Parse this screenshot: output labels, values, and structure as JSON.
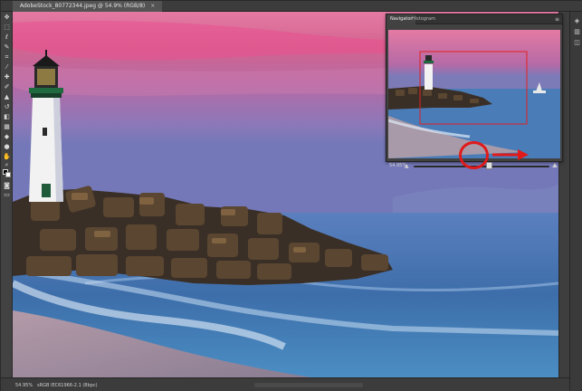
{
  "document": {
    "tab_title": "AdobeStock_80772344.jpeg @ 54.9% (RGB/8)",
    "close_glyph": "×"
  },
  "tools": {
    "icons": [
      "move-tool-icon",
      "marquee-tool-icon",
      "lasso-tool-icon",
      "quick-select-tool-icon",
      "crop-tool-icon",
      "eyedropper-tool-icon",
      "healing-brush-icon",
      "brush-tool-icon",
      "clone-stamp-icon",
      "history-brush-icon",
      "eraser-tool-icon",
      "gradient-tool-icon",
      "blur-tool-icon",
      "dodge-tool-icon",
      "pen-tool-icon",
      "type-tool-icon",
      "path-select-icon",
      "rectangle-tool-icon",
      "hand-tool-icon",
      "zoom-tool-icon",
      "more-tools-icon"
    ]
  },
  "navigator": {
    "tabs": [
      "Navigator",
      "Histogram"
    ],
    "active_tab": "Navigator",
    "menu_glyph": "≡",
    "zoom_value": "54.95%",
    "zoom_out_icon": "small-mountain-icon",
    "zoom_in_icon": "large-mountain-icon",
    "slider_level": 0.56
  },
  "status": {
    "zoom": "54.95%",
    "info": "sRGB IEC61966-2.1 (8bpc)"
  },
  "colors": {
    "annotation": "#e01a1a",
    "panel": "#424242",
    "sky_top": "#d66a9a",
    "sky_bottom": "#6f73b4",
    "water": "#3a6fa8"
  }
}
